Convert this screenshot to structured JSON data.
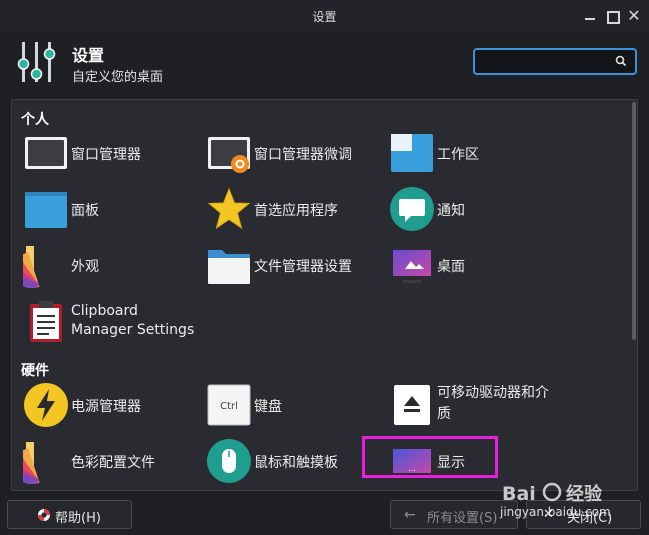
{
  "window": {
    "title": "设置"
  },
  "header": {
    "title": "设置",
    "subtitle": "自定义您的桌面",
    "search_placeholder": ""
  },
  "sections": {
    "personal": "个人",
    "hardware": "硬件"
  },
  "items": {
    "window_manager": "窗口管理器",
    "window_tweaks": "窗口管理器微调",
    "workspaces": "工作区",
    "panel": "面板",
    "preferred_apps": "首选应用程序",
    "notifications": "通知",
    "appearance": "外观",
    "file_manager": "文件管理器设置",
    "desktop": "桌面",
    "clipboard_line1": "Clipboard",
    "clipboard_line2": "Manager Settings",
    "power": "电源管理器",
    "keyboard": "键盘",
    "removable_line1": "可移动驱动器和介",
    "removable_line2": "质",
    "color_profiles": "色彩配置文件",
    "mouse": "鼠标和触摸板",
    "display": "显示"
  },
  "icons": {
    "keyboard_text": "Ctrl"
  },
  "buttons": {
    "help": "帮助(H)",
    "all_settings": "所有设置(S)",
    "close": "关闭(C)"
  },
  "watermark": {
    "url": "jingyan.baidu.com"
  },
  "colors": {
    "accent": "#3a93d8",
    "highlight": "#e81fde",
    "folder_blue": "#3aa0dd",
    "star_yellow": "#f3c623",
    "teal": "#1f9e8f"
  }
}
